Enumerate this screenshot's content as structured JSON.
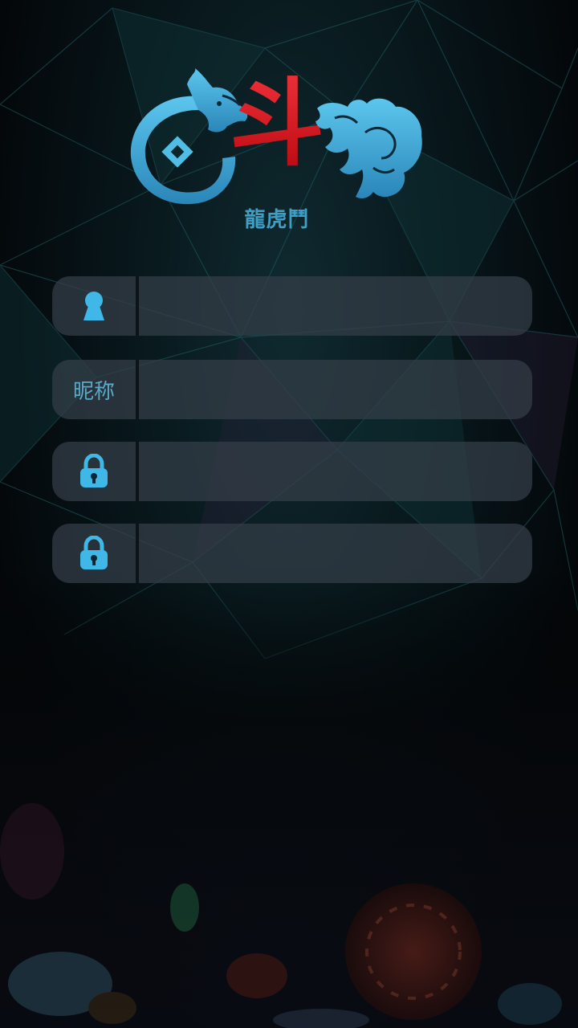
{
  "app": {
    "logo_caption": "龍虎鬥",
    "logo_glyph": "斗",
    "accent_color": "#3aa8d4",
    "logo_red": "#d5101a"
  },
  "form": {
    "fields": [
      {
        "icon": "user-icon",
        "value": "",
        "placeholder": ""
      },
      {
        "label": "昵称",
        "value": "",
        "placeholder": ""
      },
      {
        "icon": "lock-icon",
        "value": "",
        "placeholder": ""
      },
      {
        "icon": "lock-icon",
        "value": "",
        "placeholder": ""
      }
    ]
  }
}
